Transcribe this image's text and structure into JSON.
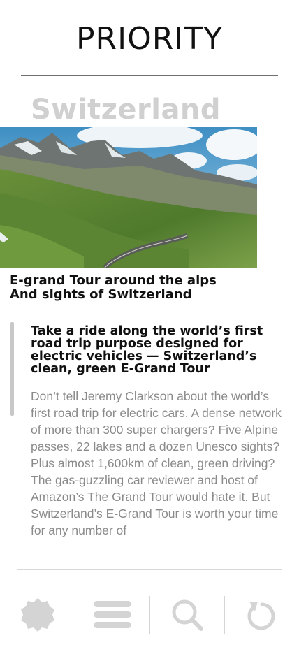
{
  "header": {
    "brand": "PRIORITY"
  },
  "article": {
    "section_title": "Switzerland",
    "image_alt": "Winding mountain road through green alpine valley",
    "caption_line1": "E-grand Tour around the alps",
    "caption_line2": "And sights of Switzerland",
    "lead": "Take a ride along the world’s first road trip purpose designed for electric vehicles — Switzerland’s clean, green E-Grand Tour",
    "body": "Don’t tell Jeremy Clarkson about the world’s first road trip for electric cars. A dense network of more than 300 super chargers? Five Alpine passes, 22 lakes and a dozen Unesco sights? Plus almost 1,600km of clean, green driving? The gas-guzzling car reviewer and host of Amazon’s The Grand Tour would hate it. But Switzerland’s E-Grand Tour is worth your time for any number of"
  },
  "toolbar": {
    "items": [
      {
        "name": "badge-icon"
      },
      {
        "name": "menu-icon"
      },
      {
        "name": "search-icon"
      },
      {
        "name": "refresh-icon"
      }
    ],
    "icon_color": "#d4d4d4"
  },
  "colors": {
    "section_title": "#d0d0d0",
    "body_text": "#8a8a8a",
    "rule": "#6f6f6f"
  }
}
